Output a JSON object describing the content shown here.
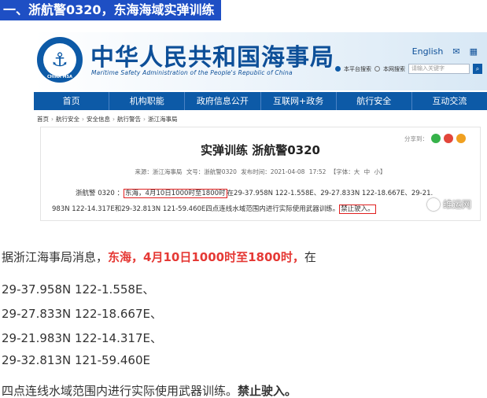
{
  "heading": "一、浙航警0320，东海海域实弹训练",
  "site": {
    "logo_text": "CHINA MSA",
    "title": "中华人民共和国海事局",
    "subtitle": "Maritime Safety Administration of the People's Republic of China",
    "lang_link": "English",
    "mail_icon": "mail-icon",
    "grid_icon": "grid-icon",
    "search_scope_1": "本平台搜索",
    "search_scope_2": "本网搜索",
    "search_placeholder": "请输入关键字",
    "search_btn": "⌕"
  },
  "nav": {
    "items": [
      "首页",
      "机构职能",
      "政府信息公开",
      "互联网+政务",
      "航行安全",
      "互动交流"
    ]
  },
  "breadcrumbs": [
    "首页",
    "航行安全",
    "安全信息",
    "航行警告",
    "浙江海事局"
  ],
  "article": {
    "share_label": "分享到：",
    "title": "实弹训练 浙航警0320",
    "meta_source": "来源：浙江海事局",
    "meta_number": "文号：浙航警0320",
    "meta_time": "发布时间：2021-04-08 17:52",
    "meta_font": "【字体：大 中 小】",
    "body_prefix": "浙航警 0320 ：",
    "body_boxed": "东海，4月10日1000时至1800时",
    "body_rest": "在29-37.958N 122-1.558E、29-27.833N 122-18.667E、29-21.",
    "body_line2": "983N 122-14.317E和29-32.813N 121-59.460E四点连线水域范围内进行实际使用武器训练。",
    "body_boxed2": "禁止驶入。"
  },
  "watermark": "维运网",
  "main": {
    "intro_prefix": "据浙江海事局消息，",
    "intro_red": "东海，4月10日1000时至1800时，",
    "intro_suffix": "在",
    "coords": [
      "29-37.958N 122-1.558E、",
      "29-27.833N 122-18.667E、",
      "29-21.983N 122-14.317E、",
      "29-32.813N 121-59.460E"
    ],
    "closing_prefix": "四点连线水域范围内进行实际使用武器训练。",
    "closing_bold": "禁止驶入。"
  },
  "colors": {
    "heading_bg": "#1e4fc4",
    "nav_bg": "#0d5aa7",
    "highlight_red": "#e53935"
  }
}
